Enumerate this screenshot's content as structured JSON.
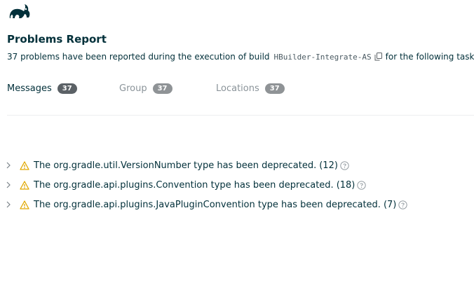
{
  "app": {
    "logo_icon": "gradle-elephant-icon",
    "brand_color": "#02303a"
  },
  "header": {
    "title": "Problems Report",
    "summary_prefix": "37 problems have been reported during the execution of build",
    "build_name": "HBuilder-Integrate-AS",
    "copy_icon": "copy-icon",
    "summary_suffix": "for the following tasks:"
  },
  "tabs": [
    {
      "label": "Messages",
      "count": "37",
      "active": true
    },
    {
      "label": "Group",
      "count": "37",
      "active": false
    },
    {
      "label": "Locations",
      "count": "37",
      "active": false
    }
  ],
  "problems": [
    {
      "text": "The org.gradle.util.VersionNumber type has been deprecated.",
      "count": "(12)"
    },
    {
      "text": "The org.gradle.api.plugins.Convention type has been deprecated.",
      "count": "(18)"
    },
    {
      "text": "The org.gradle.api.plugins.JavaPluginConvention type has been deprecated.",
      "count": "(7)"
    }
  ],
  "icons": {
    "expand": "chevron-right-icon",
    "warning": "warning-icon",
    "help": "help-icon"
  },
  "colors": {
    "warning": "#e0a800",
    "active_badge": "#5b6166",
    "inactive_badge": "#8f9396",
    "inactive_tab_text": "#8a9399"
  }
}
